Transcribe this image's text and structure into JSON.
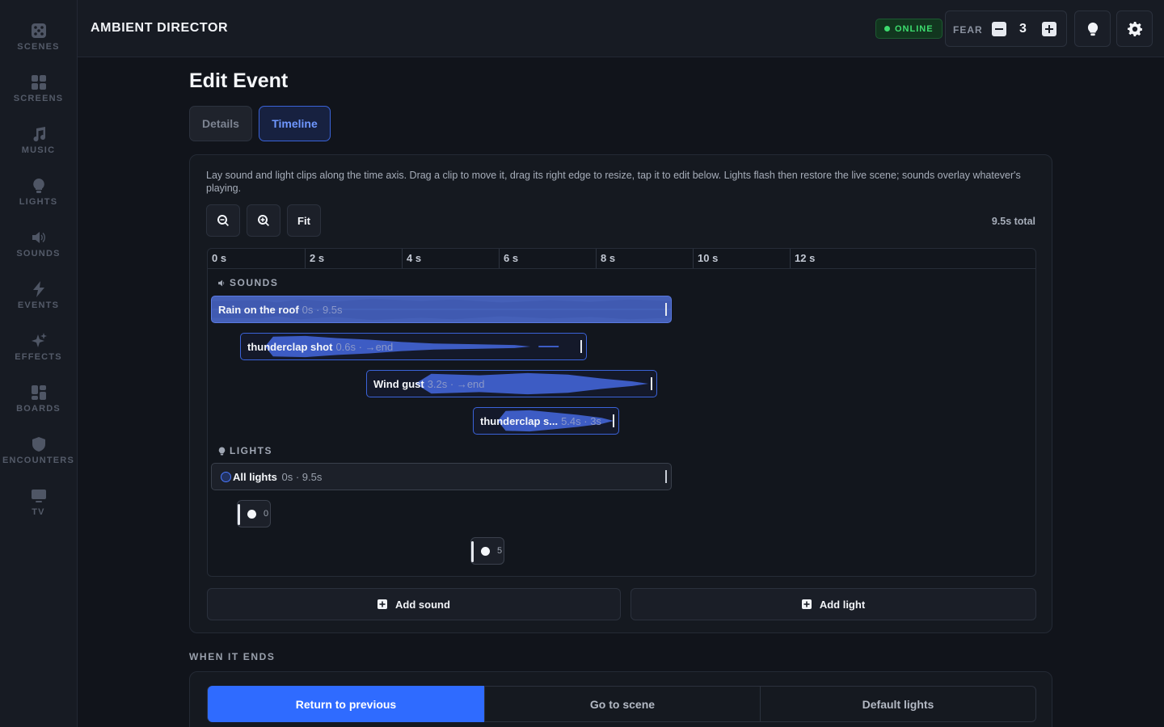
{
  "app": {
    "title": "AMBIENT DIRECTOR"
  },
  "sidebar": {
    "items": [
      {
        "label": "SCENES",
        "icon": "scenes-icon"
      },
      {
        "label": "SCREENS",
        "icon": "screens-icon"
      },
      {
        "label": "MUSIC",
        "icon": "music-icon"
      },
      {
        "label": "LIGHTS",
        "icon": "bulb-icon"
      },
      {
        "label": "SOUNDS",
        "icon": "speaker-icon"
      },
      {
        "label": "EVENTS",
        "icon": "bolt-icon"
      },
      {
        "label": "EFFECTS",
        "icon": "sparkle-icon"
      },
      {
        "label": "BOARDS",
        "icon": "boards-icon"
      },
      {
        "label": "ENCOUNTERS",
        "icon": "shield-icon"
      },
      {
        "label": "TV",
        "icon": "tv-icon"
      }
    ]
  },
  "header": {
    "status": "ONLINE",
    "status_color": "#3ddc6e",
    "fear_label": "FEAR",
    "fear_value": "3"
  },
  "page": {
    "title": "Edit Event",
    "tabs": [
      {
        "label": "Details",
        "active": false
      },
      {
        "label": "Timeline",
        "active": true
      }
    ]
  },
  "timeline": {
    "help": "Lay sound and light clips along the time axis. Drag a clip to move it, drag its right edge to resize, tap it to edit below. Lights flash then restore the live scene; sounds overlay whatever's playing.",
    "fit_label": "Fit",
    "total": "9.5s total",
    "ticks": [
      "0 s",
      "2 s",
      "4 s",
      "6 s",
      "8 s",
      "10 s",
      "12 s"
    ],
    "sounds_label": "SOUNDS",
    "lights_label": "LIGHTS",
    "sounds": [
      {
        "name": "Rain on the roof",
        "meta": "0s · 9.5s"
      },
      {
        "name": "thunderclap shot",
        "meta": "0.6s · →end"
      },
      {
        "name": "Wind gust",
        "meta": "3.2s · →end"
      },
      {
        "name": "thunderclap s...",
        "meta": "5.4s · 3s"
      }
    ],
    "lights": [
      {
        "name": "All lights",
        "meta": "0s · 9.5s"
      },
      {
        "name": "",
        "meta": "0"
      },
      {
        "name": "",
        "meta": "5"
      }
    ],
    "add_sound": "Add sound",
    "add_light": "Add light"
  },
  "when_ends": {
    "label": "WHEN IT ENDS",
    "options": [
      {
        "label": "Return to previous",
        "selected": true
      },
      {
        "label": "Go to scene",
        "selected": false
      },
      {
        "label": "Default lights",
        "selected": false
      }
    ]
  },
  "colors": {
    "accent": "#2f6bff",
    "clip_border": "#3b63d9",
    "clip_fill": "#4560b8"
  }
}
